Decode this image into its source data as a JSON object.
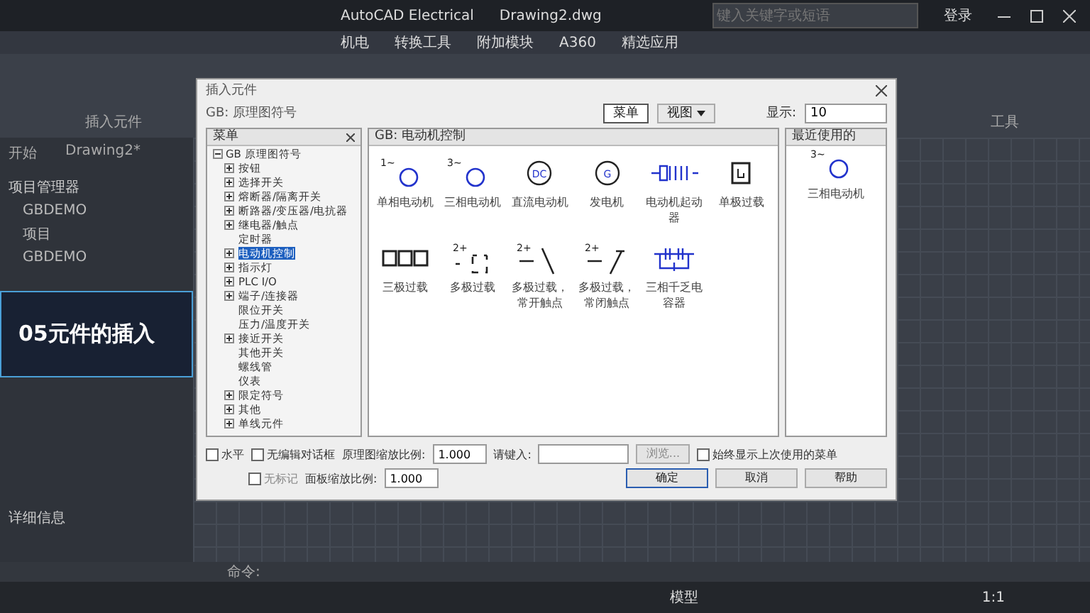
{
  "app": {
    "title": "AutoCAD Electrical",
    "document": "Drawing2.dwg",
    "search": {
      "placeholder": "键入关键字或短语"
    },
    "login": "登录"
  },
  "ribbon": {
    "tabs": [
      "机电",
      "转换工具",
      "附加模块",
      "A360",
      "精选应用"
    ],
    "panel_label": "插入元件",
    "right_label": "工具"
  },
  "left_panel": {
    "doc_tabs": [
      "开始",
      "Drawing2*"
    ],
    "title": "项目管理器",
    "projects": [
      "GBDEMO",
      "项目",
      "GBDEMO"
    ],
    "details_title": "详细信息"
  },
  "course_card": {
    "title": "05元件的插入"
  },
  "status_bar": {
    "model": "模型",
    "scale": "1:1",
    "command": "命令:"
  },
  "dialog": {
    "title": "插入元件",
    "breadcrumb": "GB: 原理图符号",
    "menu_button": "菜单",
    "view_button": "视图",
    "display_label": "显示:",
    "display_value": "10",
    "tree": {
      "header": "菜单",
      "root": {
        "prefix": "GB",
        "label": "原理图符号",
        "children": [
          {
            "label": "按钮",
            "expandable": true,
            "selected": false
          },
          {
            "label": "选择开关",
            "expandable": true,
            "selected": false
          },
          {
            "label": "熔断器/隔离开关",
            "expandable": true,
            "selected": false
          },
          {
            "label": "断路器/变压器/电抗器",
            "expandable": true,
            "selected": false
          },
          {
            "label": "继电器/触点",
            "expandable": true,
            "selected": false
          },
          {
            "label": "定时器",
            "expandable": false,
            "selected": false
          },
          {
            "label": "电动机控制",
            "expandable": true,
            "selected": true
          },
          {
            "label": "指示灯",
            "expandable": true,
            "selected": false
          },
          {
            "label": "PLC I/O",
            "expandable": true,
            "selected": false
          },
          {
            "label": "端子/连接器",
            "expandable": true,
            "selected": false
          },
          {
            "label": "限位开关",
            "expandable": false,
            "selected": false
          },
          {
            "label": "压力/温度开关",
            "expandable": false,
            "selected": false
          },
          {
            "label": "接近开关",
            "expandable": true,
            "selected": false
          },
          {
            "label": "其他开关",
            "expandable": false,
            "selected": false
          },
          {
            "label": "螺线管",
            "expandable": false,
            "selected": false
          },
          {
            "label": "仪表",
            "expandable": false,
            "selected": false
          },
          {
            "label": "限定符号",
            "expandable": true,
            "selected": false
          },
          {
            "label": "其他",
            "expandable": true,
            "selected": false
          },
          {
            "label": "单线元件",
            "expandable": true,
            "selected": false
          }
        ]
      }
    },
    "symbols_header": "GB: 电动机控制",
    "symbols": [
      {
        "kind": "motor",
        "mark": "1~",
        "label": "单相电动机"
      },
      {
        "kind": "motor",
        "mark": "3~",
        "label": "三相电动机"
      },
      {
        "kind": "dc_motor",
        "mark": "DC",
        "label": "直流电动机"
      },
      {
        "kind": "generator",
        "mark": "G",
        "label": "发电机"
      },
      {
        "kind": "starter",
        "label": "电动机起动器"
      },
      {
        "kind": "overload",
        "label": "单极过载"
      },
      {
        "kind": "overload3",
        "label": "三极过载"
      },
      {
        "kind": "multi_overload",
        "mark": "2+",
        "label": "多极过载"
      },
      {
        "kind": "no_contact",
        "mark": "2+",
        "label": "多极过载，常开触点"
      },
      {
        "kind": "nc_contact",
        "mark": "2+",
        "label": "多极过载，常闭触点"
      },
      {
        "kind": "capacitor",
        "label": "三相千乏电容器"
      }
    ],
    "recent_header": "最近使用的",
    "recent": [
      {
        "kind": "motor",
        "mark": "3~",
        "label": "三相电动机"
      }
    ],
    "options": {
      "horizontal": {
        "label": "水平",
        "checked": false
      },
      "no_edit": {
        "label": "无编辑对话框",
        "checked": false
      },
      "no_tag": {
        "label": "无标记",
        "checked": false,
        "disabled": true
      },
      "always_show": {
        "label": "始终显示上次使用的菜单",
        "checked": false
      }
    },
    "schematic_scale_label": "原理图缩放比例:",
    "schematic_scale": "1.000",
    "panel_scale_label": "面板缩放比例:",
    "panel_scale": "1.000",
    "type_label": "请键入:",
    "browse": "浏览...",
    "buttons": [
      "确定",
      "取消",
      "帮助"
    ]
  }
}
